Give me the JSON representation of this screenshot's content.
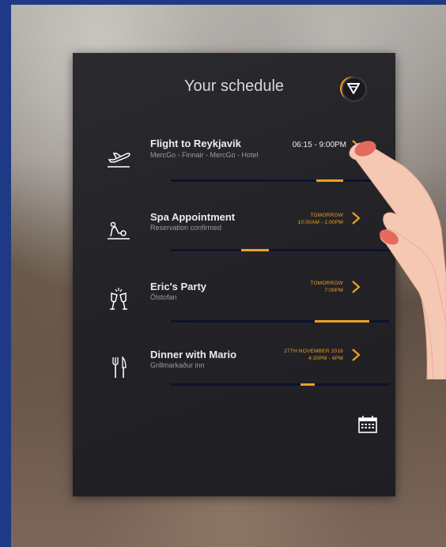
{
  "header": {
    "title": "Your schedule"
  },
  "items": [
    {
      "title": "Flight to Reykjavik",
      "subtitle": "MercGo - Finnair - MercGo - Hotel",
      "time_main": "06:15 - 9:00PM",
      "icon": "plane-departure-icon",
      "progress": 0.12
    },
    {
      "title": "Spa Appointment",
      "subtitle": "Reservation confirmed",
      "time_line1": "TOMORROW",
      "time_line2": "10:00AM - 1:00PM",
      "icon": "spa-massage-icon",
      "progress": 0.35
    },
    {
      "title": "Eric's Party",
      "subtitle": "Ölstofan",
      "time_line1": "TOMORROW",
      "time_line2": "7:00PM",
      "icon": "champagne-glasses-icon",
      "progress": 0.25
    },
    {
      "title": "Dinner with Mario",
      "subtitle": "Grillmarkaður inn",
      "time_line1": "27TH NOVEMBER 2016",
      "time_line2": "4:30PM - 6PM",
      "icon": "fork-knife-icon",
      "progress": 0.06
    }
  ],
  "colors": {
    "accent": "#f0a020",
    "panel": "#232327",
    "track": "#0d1230"
  }
}
